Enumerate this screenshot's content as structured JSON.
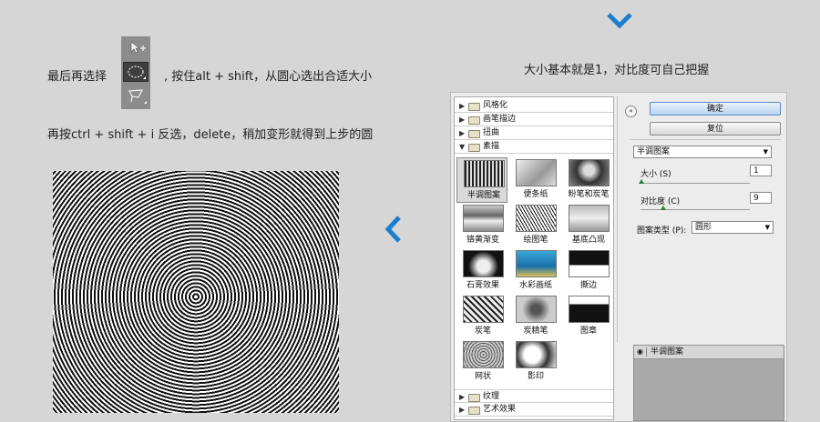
{
  "instructions": {
    "line1_prefix": "最后再选择",
    "line1_suffix": ", 按住alt + shift，从圆心选出合适大小",
    "line2": "再按ctrl + shift + i 反选，delete，稍加变形就得到上步的圆",
    "right_caption": "大小基本就是1，对比度可自己把握"
  },
  "toolbox": {
    "tools": [
      "move-tool",
      "elliptical-marquee-tool",
      "lasso-tool"
    ]
  },
  "filter_gallery": {
    "categories_top": [
      {
        "label": "风格化",
        "expanded": false
      },
      {
        "label": "画笔描边",
        "expanded": false
      },
      {
        "label": "扭曲",
        "expanded": false
      },
      {
        "label": "素描",
        "expanded": true
      }
    ],
    "thumbnails": [
      {
        "label": "半调图案",
        "selected": true
      },
      {
        "label": "便条纸",
        "selected": false
      },
      {
        "label": "粉笔和炭笔",
        "selected": false
      },
      {
        "label": "铬黄渐变",
        "selected": false
      },
      {
        "label": "绘图笔",
        "selected": false
      },
      {
        "label": "基底凸现",
        "selected": false
      },
      {
        "label": "石膏效果",
        "selected": false
      },
      {
        "label": "水彩画纸",
        "selected": false
      },
      {
        "label": "撕边",
        "selected": false
      },
      {
        "label": "炭笔",
        "selected": false
      },
      {
        "label": "炭精笔",
        "selected": false
      },
      {
        "label": "图章",
        "selected": false
      },
      {
        "label": "网状",
        "selected": false
      },
      {
        "label": "影印",
        "selected": false
      }
    ],
    "categories_bottom": [
      {
        "label": "纹理",
        "expanded": false
      },
      {
        "label": "艺术效果",
        "expanded": false
      }
    ],
    "ok_label": "确定",
    "reset_label": "复位",
    "filter_select": "半调图案",
    "size_label": "大小 (S)",
    "size_value": "1",
    "contrast_label": "对比度 (C)",
    "contrast_value": "9",
    "pattern_type_label": "图案类型 (P):",
    "pattern_type_value": "圆形",
    "layer_name": "半调图案"
  },
  "colors": {
    "accent_chevron": "#1a7fd0",
    "background": "#d6d6d6"
  }
}
